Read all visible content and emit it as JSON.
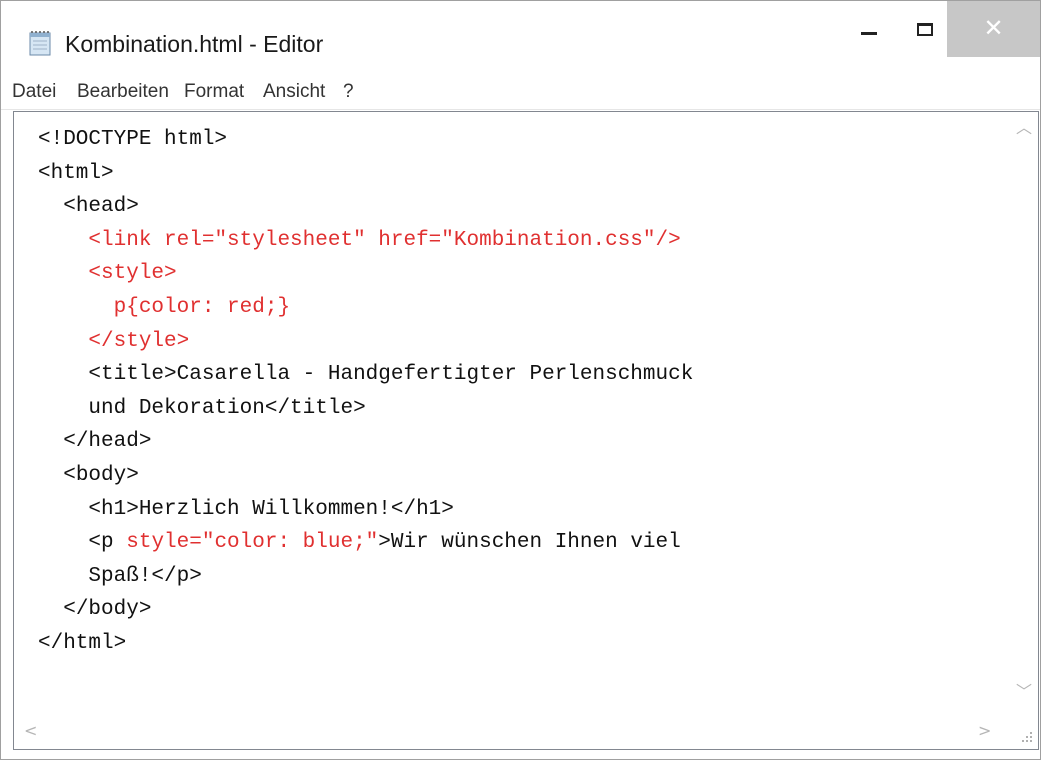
{
  "window": {
    "title": "Kombination.html - Editor"
  },
  "controls": {
    "minimize_icon": "minimize-icon",
    "maximize_icon": "maximize-icon",
    "close_icon": "close-icon",
    "close_symbol": "✕"
  },
  "menu": {
    "items": [
      {
        "label": "Datei"
      },
      {
        "label": "Bearbeiten"
      },
      {
        "label": "Format"
      },
      {
        "label": "Ansicht"
      },
      {
        "label": "?"
      }
    ]
  },
  "editor": {
    "lines": [
      {
        "indent": "",
        "parts": [
          "<!DOCTYPE html>"
        ]
      },
      {
        "indent": "",
        "parts": [
          "<html>"
        ]
      },
      {
        "indent": "  ",
        "parts": [
          "<head>"
        ]
      },
      {
        "indent": "    ",
        "parts": [
          "<link rel=\"stylesheet\" href=\"Kombination.css\"/>"
        ]
      },
      {
        "indent": "    ",
        "parts": [
          "<style>"
        ]
      },
      {
        "indent": "      ",
        "parts": [
          "p{color: red;}"
        ]
      },
      {
        "indent": "    ",
        "parts": [
          "</style>"
        ]
      },
      {
        "indent": "    ",
        "parts": [
          "<title>Casarella - Handgefertigter Perlenschmuck"
        ]
      },
      {
        "indent": "    ",
        "parts": [
          "und Dekoration</title>"
        ]
      },
      {
        "indent": "  ",
        "parts": [
          "</head>"
        ]
      },
      {
        "indent": "  ",
        "parts": [
          "<body>"
        ]
      },
      {
        "indent": "    ",
        "parts": [
          "<h1>Herzlich Willkommen!</h1>"
        ]
      },
      {
        "indent": "    ",
        "parts": [
          "<p ",
          "style=\"color: blue;\"",
          ">Wir wünschen Ihnen viel"
        ]
      },
      {
        "indent": "    ",
        "parts": [
          "Spaß!</p>"
        ]
      },
      {
        "indent": "  ",
        "parts": [
          "</body>"
        ]
      },
      {
        "indent": "",
        "parts": [
          "</html>"
        ]
      }
    ],
    "red_text_color": "#e03030"
  },
  "scrollbars": {
    "up_arrow": "︿",
    "down_arrow": "﹀",
    "left_arrow": "<",
    "right_arrow": ">"
  }
}
